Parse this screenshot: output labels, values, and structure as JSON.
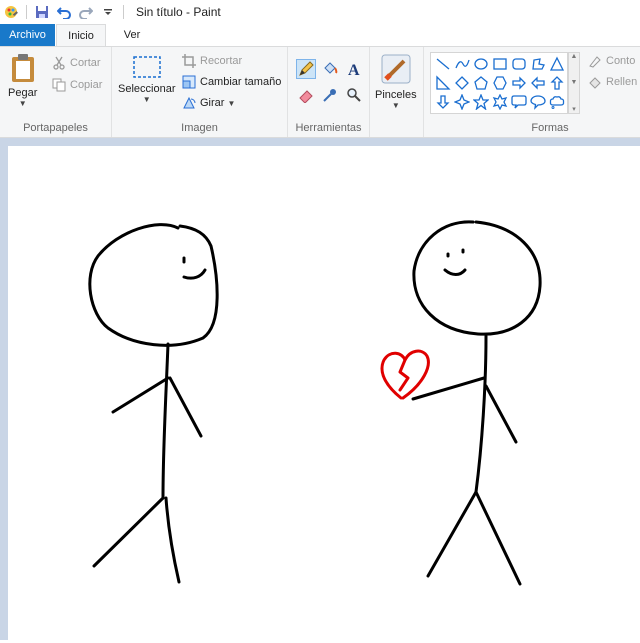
{
  "window": {
    "title": "Sin título - Paint"
  },
  "quick_access": {
    "icons": [
      "paint-app-icon",
      "save-icon",
      "undo-icon",
      "redo-icon",
      "customize-arrow-icon"
    ]
  },
  "tabs": {
    "file": "Archivo",
    "home": "Inicio",
    "view": "Ver"
  },
  "ribbon": {
    "clipboard": {
      "label": "Portapapeles",
      "paste": "Pegar",
      "cut": "Cortar",
      "copy": "Copiar"
    },
    "image": {
      "label": "Imagen",
      "select": "Seleccionar",
      "crop": "Recortar",
      "resize": "Cambiar tamaño",
      "rotate": "Girar"
    },
    "tools": {
      "label": "Herramientas",
      "selected": "pencil-icon"
    },
    "brushes": {
      "label": "Pinceles"
    },
    "shapes": {
      "label": "Formas",
      "outline": "Conto",
      "fill": "Rellen"
    }
  },
  "colors": {
    "accent": "#1979ca",
    "ribbon_bg": "#f5f6f7",
    "canvas_bg": "#c9d5e6",
    "heart": "#e00000"
  },
  "drawing": {
    "figures": [
      "left-stick-figure",
      "right-stick-figure"
    ],
    "heart": "broken-heart"
  }
}
